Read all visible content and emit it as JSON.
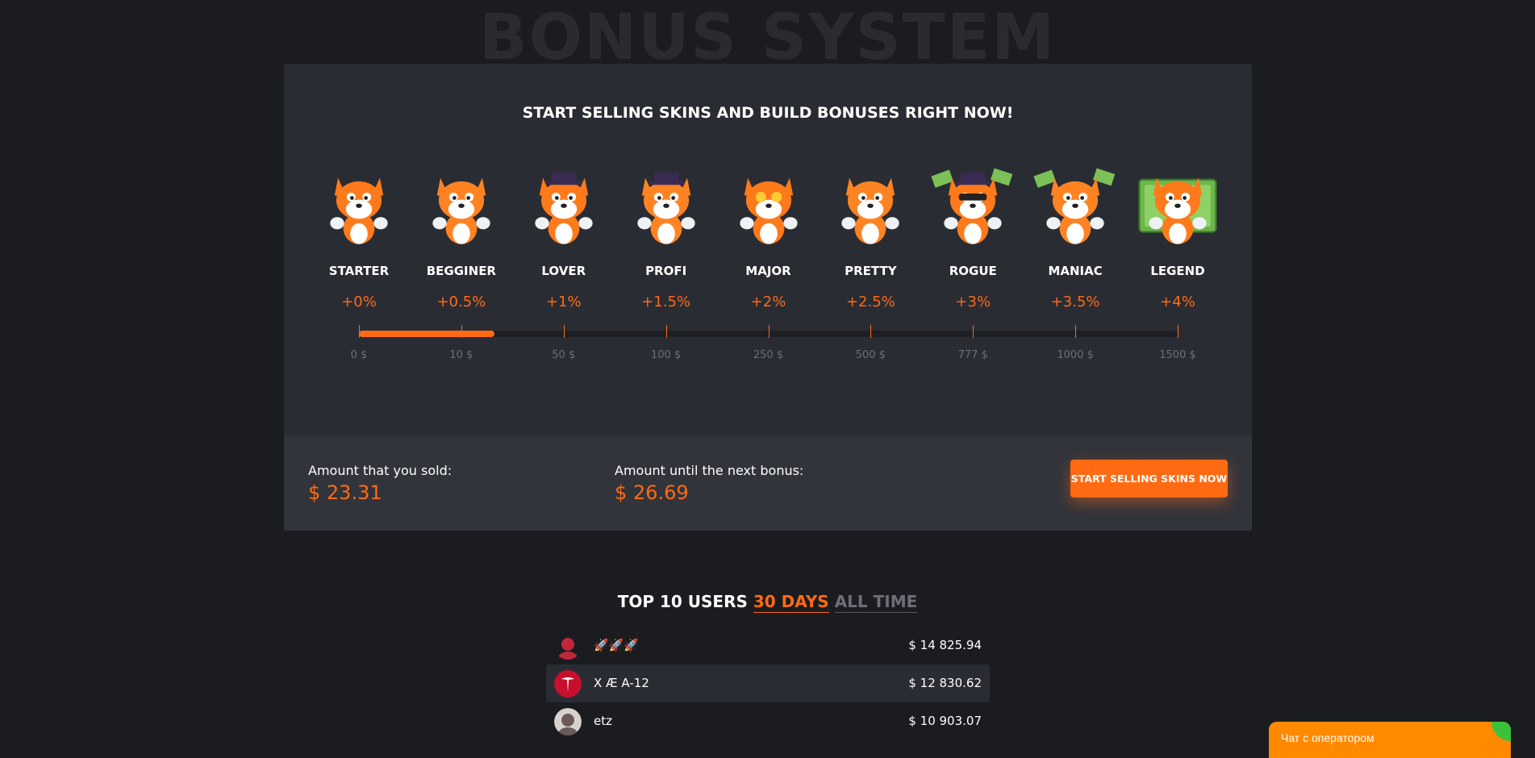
{
  "page": {
    "bg_title": "BONUS SYSTEM"
  },
  "panel": {
    "headline": "START SELLING SKINS AND BUILD BONUSES RIGHT NOW!",
    "ranks": [
      {
        "name": "STARTER",
        "bonus": "+0%",
        "threshold": "0 $",
        "icon": "fox-starter-icon"
      },
      {
        "name": "BEGGINER",
        "bonus": "+0.5%",
        "threshold": "10 $",
        "icon": "fox-begginer-icon"
      },
      {
        "name": "LOVER",
        "bonus": "+1%",
        "threshold": "50 $",
        "icon": "fox-lover-icon"
      },
      {
        "name": "PROFI",
        "bonus": "+1.5%",
        "threshold": "100 $",
        "icon": "fox-profi-icon"
      },
      {
        "name": "MAJOR",
        "bonus": "+2%",
        "threshold": "250 $",
        "icon": "fox-major-icon"
      },
      {
        "name": "PRETTY",
        "bonus": "+2.5%",
        "threshold": "500 $",
        "icon": "fox-pretty-icon"
      },
      {
        "name": "ROGUE",
        "bonus": "+3%",
        "threshold": "777 $",
        "icon": "fox-rogue-icon"
      },
      {
        "name": "MANIAC",
        "bonus": "+3.5%",
        "threshold": "1000 $",
        "icon": "fox-maniac-icon"
      },
      {
        "name": "LEGEND",
        "bonus": "+4%",
        "threshold": "1500 $",
        "icon": "fox-legend-icon"
      }
    ],
    "progress_fraction": 0.166,
    "sold_label": "Amount that you sold:",
    "sold_value": "$ 23.31",
    "next_label": "Amount until the next bonus:",
    "next_value": "$ 26.69",
    "sell_button": "START SELLING SKINS NOW"
  },
  "top": {
    "title": "TOP 10 USERS",
    "tab_30": "30 DAYS",
    "tab_all": "ALL TIME",
    "users": [
      {
        "name": "🚀🚀🚀",
        "amount": "$ 14 825.94",
        "avatar": "avatar-red-icon"
      },
      {
        "name": "X Æ A-12",
        "amount": "$ 12 830.62",
        "avatar": "avatar-tesla-icon"
      },
      {
        "name": "etz",
        "amount": "$ 10 903.07",
        "avatar": "avatar-anime-icon"
      }
    ]
  },
  "chat": {
    "label": "Чат с оператором"
  },
  "colors": {
    "accent": "#ff6a13",
    "panel": "#2a2c33",
    "bg": "#1b1c20"
  }
}
